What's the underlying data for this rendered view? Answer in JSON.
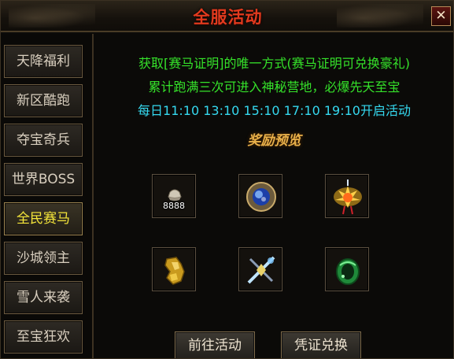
{
  "window": {
    "title": "全服活动",
    "close_icon": "close-icon"
  },
  "sidebar": {
    "items": [
      {
        "label": "天降福利",
        "active": false
      },
      {
        "label": "新区酷跑",
        "active": false
      },
      {
        "label": "夺宝奇兵",
        "active": false
      },
      {
        "label": "世界BOSS",
        "active": false
      },
      {
        "label": "全民赛马",
        "active": true
      },
      {
        "label": "沙城领主",
        "active": false
      },
      {
        "label": "雪人来袭",
        "active": false
      },
      {
        "label": "至宝狂欢",
        "active": false
      }
    ]
  },
  "main": {
    "line1": "获取[赛马证明]的唯一方式(赛马证明可兑换豪礼)",
    "line2": "累计跑满三次可进入神秘营地，必爆先天至宝",
    "line3": "每日11:10 13:10 15:10 17:10 19:10开启活动",
    "rewards_title": "奖励预览",
    "rewards": [
      {
        "icon": "gold-ingot-icon",
        "qty": "8888"
      },
      {
        "icon": "blue-gem-orb-icon",
        "qty": ""
      },
      {
        "icon": "flaming-lotus-icon",
        "qty": ""
      },
      {
        "icon": "golden-gauntlet-icon",
        "qty": ""
      },
      {
        "icon": "crossed-blades-icon",
        "qty": ""
      },
      {
        "icon": "jade-ring-icon",
        "qty": ""
      }
    ],
    "buttons": {
      "goto": "前往活动",
      "exchange": "凭证兑换"
    }
  },
  "colors": {
    "title": "#e23a1e",
    "highlight_text": "#35e22a",
    "time_text": "#35d9f0",
    "active_tab": "#f4e53a",
    "rewards_title": "#e8b04a"
  }
}
